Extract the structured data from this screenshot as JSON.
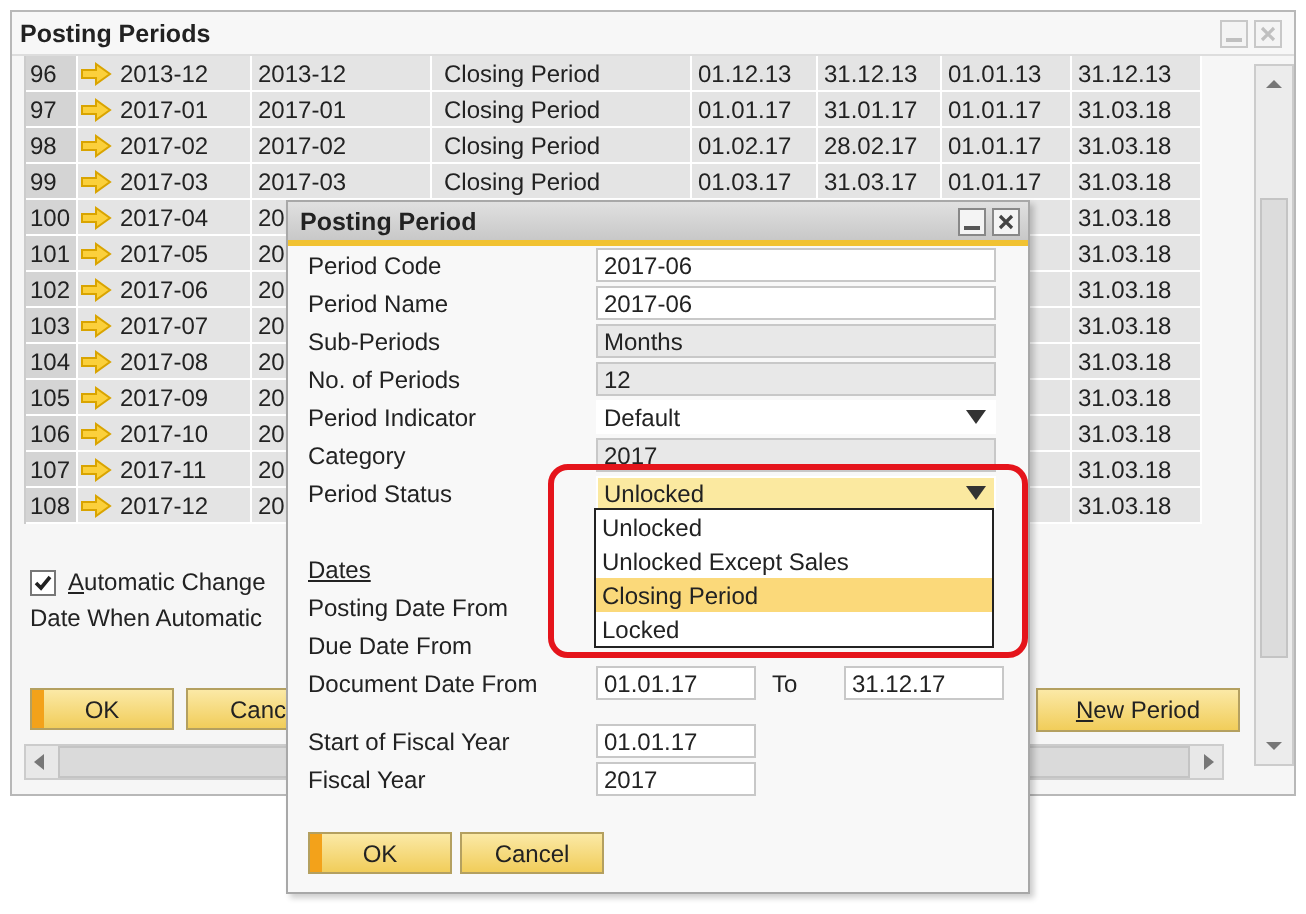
{
  "main_window": {
    "title": "Posting Periods",
    "rows": [
      {
        "cells": [
          "96",
          "2013-12",
          "2013-12",
          "Closing Period",
          "01.12.13",
          "31.12.13",
          "01.01.13",
          "31.12.13"
        ]
      },
      {
        "cells": [
          "97",
          "2017-01",
          "2017-01",
          "Closing Period",
          "01.01.17",
          "31.01.17",
          "01.01.17",
          "31.03.18"
        ]
      },
      {
        "cells": [
          "98",
          "2017-02",
          "2017-02",
          "Closing Period",
          "01.02.17",
          "28.02.17",
          "01.01.17",
          "31.03.18"
        ]
      },
      {
        "cells": [
          "99",
          "2017-03",
          "2017-03",
          "Closing Period",
          "01.03.17",
          "31.03.17",
          "01.01.17",
          "31.03.18"
        ]
      },
      {
        "cells": [
          "100",
          "2017-04",
          "20",
          null,
          null,
          null,
          null,
          "31.03.18"
        ]
      },
      {
        "cells": [
          "101",
          "2017-05",
          "20",
          null,
          null,
          null,
          null,
          "31.03.18"
        ]
      },
      {
        "cells": [
          "102",
          "2017-06",
          "20",
          null,
          null,
          null,
          null,
          "31.03.18"
        ]
      },
      {
        "cells": [
          "103",
          "2017-07",
          "20",
          null,
          null,
          null,
          null,
          "31.03.18"
        ]
      },
      {
        "cells": [
          "104",
          "2017-08",
          "20",
          null,
          null,
          null,
          null,
          "31.03.18"
        ]
      },
      {
        "cells": [
          "105",
          "2017-09",
          "20",
          null,
          null,
          null,
          null,
          "31.03.18"
        ]
      },
      {
        "cells": [
          "106",
          "2017-10",
          "20",
          null,
          null,
          null,
          null,
          "31.03.18"
        ]
      },
      {
        "cells": [
          "107",
          "2017-11",
          "20",
          null,
          null,
          null,
          null,
          "31.03.18"
        ]
      },
      {
        "cells": [
          "108",
          "2017-12",
          "20",
          null,
          null,
          null,
          null,
          "31.03.18"
        ]
      }
    ],
    "automatic_change": {
      "label": "Automatic Change",
      "checked": true
    },
    "date_when_label": "Date When Automatic",
    "buttons": [
      {
        "label": "OK",
        "default": true
      },
      {
        "label": "Canc",
        "default": false
      }
    ],
    "new_period_button": {
      "label": "New Period",
      "default": false
    }
  },
  "dialog": {
    "title": "Posting Period",
    "fields": [
      {
        "label": "Period Code",
        "value": "2017-06",
        "kind": "text"
      },
      {
        "label": "Period Name",
        "value": "2017-06",
        "kind": "text"
      },
      {
        "label": "Sub-Periods",
        "value": "Months",
        "kind": "readonly"
      },
      {
        "label": "No. of Periods",
        "value": "12",
        "kind": "readonly"
      },
      {
        "label": "Period Indicator",
        "value": "Default",
        "kind": "dropdown",
        "open": false
      },
      {
        "label": "Category",
        "value": "2017",
        "kind": "readonly"
      },
      {
        "label": "Period Status",
        "value": "Unlocked",
        "kind": "dropdown",
        "open": true
      }
    ],
    "status_options": [
      {
        "label": "Unlocked",
        "selected": false
      },
      {
        "label": "Unlocked Except Sales",
        "selected": false
      },
      {
        "label": "Closing Period",
        "selected": true
      },
      {
        "label": "Locked",
        "selected": false
      }
    ],
    "dates_heading": "Dates",
    "date_rows": [
      {
        "label": "Posting Date From"
      },
      {
        "label": "Due Date From"
      },
      {
        "label": "Document Date From",
        "from": "01.01.17",
        "to_label": "To",
        "to": "31.12.17"
      }
    ],
    "fiscal_fields": [
      {
        "label": "Start of Fiscal Year",
        "value": "01.01.17"
      },
      {
        "label": "Fiscal Year",
        "value": "2017"
      }
    ],
    "buttons": [
      {
        "label": "OK",
        "default": true
      },
      {
        "label": "Cancel",
        "default": false
      }
    ]
  }
}
